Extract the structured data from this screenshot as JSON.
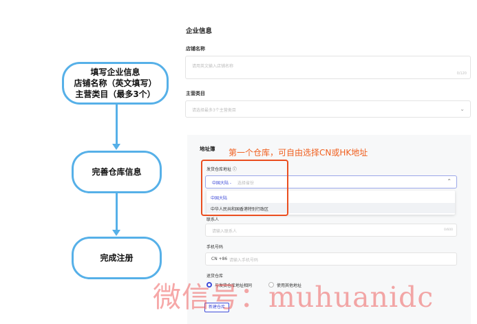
{
  "flowchart": {
    "step1": {
      "line1": "填写企业信息",
      "line2": "店铺名称（英文填写）",
      "line3": "主营类目（最多3个）"
    },
    "step2": {
      "label": "完善仓库信息"
    },
    "step3": {
      "label": "完成注册"
    },
    "color": "#56b0e8"
  },
  "form": {
    "section_title": "企业信息",
    "store_name": {
      "label": "店铺名称",
      "placeholder": "请用英文输入店铺名称",
      "counter": "0/120"
    },
    "main_category": {
      "label": "主营类目",
      "placeholder": "请选择最多3个主营类目",
      "icon": "chevron-down-icon"
    }
  },
  "address": {
    "title": "地址簿",
    "annotation": "第一个仓库，可自由选择CN或HK地址",
    "annotation_color": "#f06020",
    "ship_from": {
      "label": "发货仓库地址 ⓘ",
      "value": "中国大陆 -",
      "placeholder": "选择省份",
      "icon": "chevron-up-icon"
    },
    "dropdown_options": [
      "中国大陆",
      "中华人民共和国香港特别行政区"
    ],
    "contact": {
      "label": "联系人",
      "placeholder": "请输入联系人",
      "counter": "0/600"
    },
    "phone": {
      "label": "手机号码",
      "prefix": "CN +86",
      "placeholder": "请输入手机号码"
    },
    "return_warehouse": {
      "label": "退货仓库",
      "options": [
        "与发货仓库地址相同",
        "使用其他地址"
      ],
      "selected": 0
    },
    "new_warehouse_button": "新建仓库",
    "highlight_color": "#ea4d1e",
    "accent_color": "#3e4bd8"
  },
  "watermark": "微信号：muhuanidc"
}
